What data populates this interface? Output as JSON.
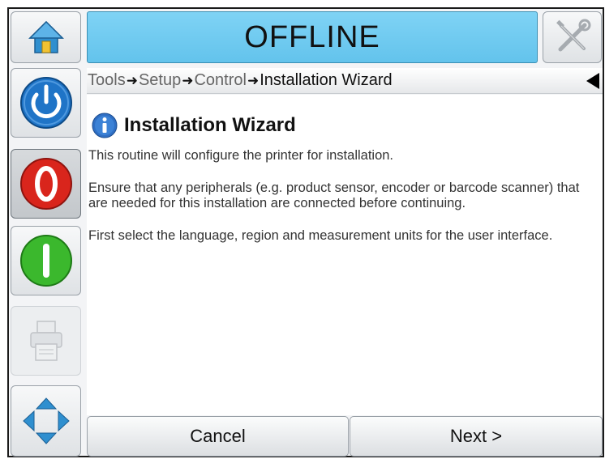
{
  "header": {
    "status": "OFFLINE"
  },
  "breadcrumb": {
    "items": [
      "Tools",
      "Setup",
      "Control"
    ],
    "current": "Installation Wizard"
  },
  "page": {
    "title": "Installation Wizard",
    "paragraphs": [
      "This routine will configure the printer for installation.",
      "Ensure that any peripherals (e.g. product sensor, encoder or barcode scanner) that are needed for this installation are connected before continuing.",
      "First select the language, region and measurement units for the user interface."
    ]
  },
  "footer": {
    "cancel_label": "Cancel",
    "next_label": "Next >"
  },
  "icons": {
    "home": "home-icon",
    "tools": "tools-icon",
    "power": "power-icon",
    "stop": "stop-icon",
    "start": "start-icon",
    "printer": "printer-icon",
    "navigate": "navigate-icon",
    "info": "info-icon",
    "back": "back-arrow-icon"
  },
  "colors": {
    "status_bar": "#6ccaf0",
    "power": "#1f74c7",
    "stop": "#d9251c",
    "start": "#3bb82d"
  }
}
